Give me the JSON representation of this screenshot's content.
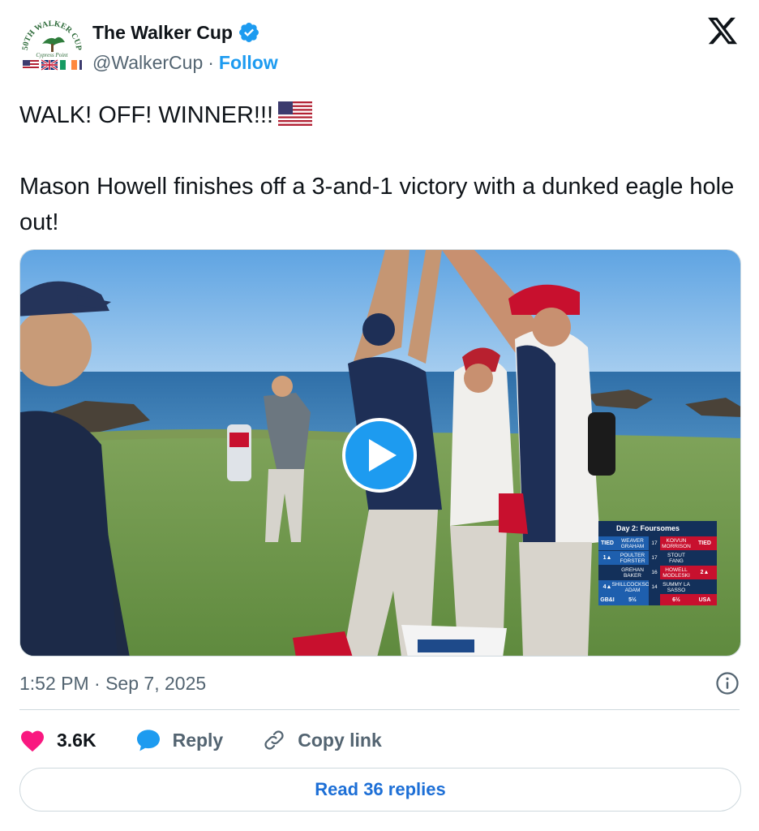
{
  "account": {
    "display_name": "The Walker Cup",
    "handle": "@WalkerCup",
    "separator": "·",
    "follow_label": "Follow",
    "avatar": {
      "arc_text": "50TH WALKER CUP",
      "venue_text": "Cypress Point",
      "icon": "walker-cup-logo"
    },
    "verified_icon": "verified-badge-icon"
  },
  "platform_icon": "x-logo-icon",
  "tweet": {
    "line1": "WALK! OFF! WINNER!!!",
    "line1_emoji": "us-flag-emoji",
    "line2": "Mason Howell finishes off a 3-and-1 victory with a dunked eagle hole out!"
  },
  "media": {
    "type": "video",
    "play_icon": "play-icon",
    "scoreboard": {
      "title": "Day 2: Foursomes",
      "rows": [
        {
          "left_status": "TIED",
          "gbi": "WEAVER GRAHAM",
          "hole": "17",
          "usa": "KOIVUN MORRISON",
          "right_status": "TIED"
        },
        {
          "left_status": "1▲",
          "gbi": "POULTER FORSTER",
          "hole": "17",
          "usa": "STOUT FANG",
          "right_status": ""
        },
        {
          "left_status": "",
          "gbi": "GREHAN BAKER",
          "hole": "16",
          "usa": "HOWELL MODLESKI",
          "right_status": "2▲"
        },
        {
          "left_status": "4▲",
          "gbi": "SHILLCOCKSON ADAM",
          "hole": "14",
          "usa": "SUMMY LA SASSO",
          "right_status": ""
        }
      ],
      "footer": {
        "left_team": "GB&I",
        "left_score": "5½",
        "right_score": "6½",
        "right_team": "USA"
      }
    }
  },
  "timestamp": "1:52 PM · Sep 7, 2025",
  "info_icon": "info-icon",
  "actions": {
    "like_count": "3.6K",
    "reply_label": "Reply",
    "copy_link_label": "Copy link"
  },
  "read_replies_label": "Read 36 replies",
  "colors": {
    "text": "#0f1419",
    "secondary": "#536471",
    "accent": "#1d9bf0",
    "like": "#f91880",
    "border": "#cfd9de"
  }
}
